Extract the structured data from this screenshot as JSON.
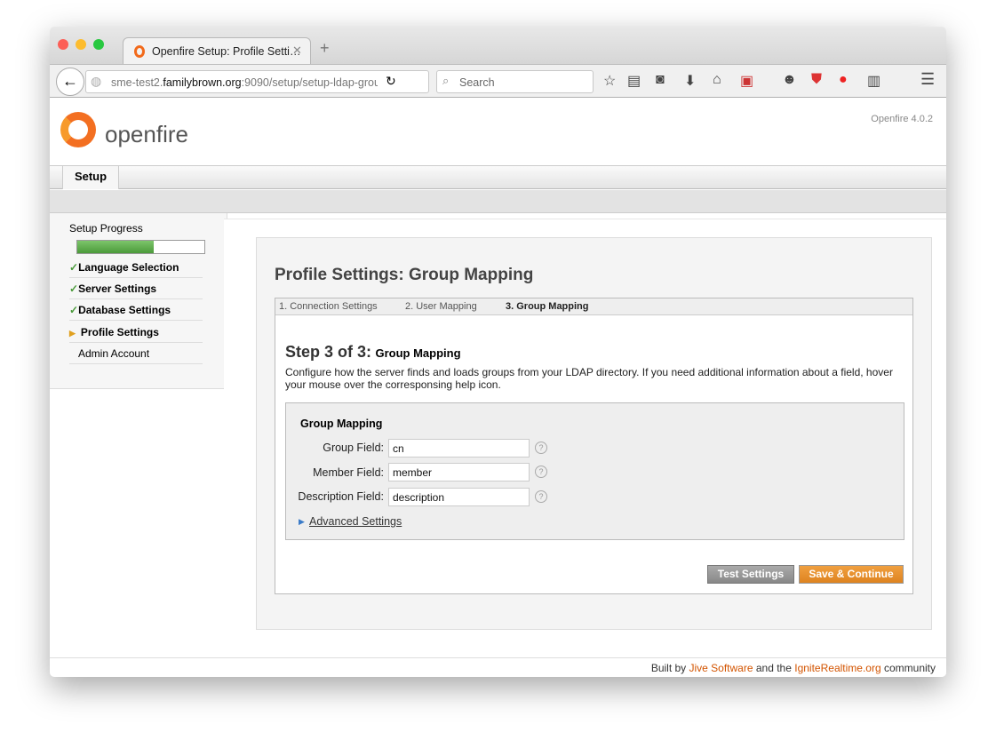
{
  "browser": {
    "tab_title": "Openfire Setup: Profile Setti…",
    "url_host_pre": "sme-test2.",
    "url_host": "familybrown.org",
    "url_rest": ":9090/setup/setup-ldap-grou",
    "search_placeholder": "Search"
  },
  "header": {
    "logo_text": "openfire",
    "version": "Openfire 4.0.2"
  },
  "nav": {
    "tab": "Setup"
  },
  "sidebar": {
    "title": "Setup Progress",
    "progress_percent": 60,
    "items": [
      {
        "label": "Language Selection",
        "state": "done"
      },
      {
        "label": "Server Settings",
        "state": "done"
      },
      {
        "label": "Database Settings",
        "state": "done"
      },
      {
        "label": "Profile Settings",
        "state": "current"
      },
      {
        "label": "Admin Account",
        "state": "pending"
      }
    ]
  },
  "main": {
    "title": "Profile Settings: Group Mapping",
    "steps": [
      "1. Connection Settings",
      "2. User Mapping",
      "3. Group Mapping"
    ],
    "step_heading": "Step 3 of 3:",
    "step_sub": "Group Mapping",
    "description": "Configure how the server finds and loads groups from your LDAP directory. If you need additional information about a field, hover your mouse over the corresponsing help icon.",
    "section_title": "Group Mapping",
    "fields": [
      {
        "label": "Group Field:",
        "value": "cn"
      },
      {
        "label": "Member Field:",
        "value": "member"
      },
      {
        "label": "Description Field:",
        "value": "description"
      }
    ],
    "advanced": "Advanced Settings",
    "test_button": "Test Settings",
    "save_button": "Save & Continue"
  },
  "footer": {
    "pre": "Built by ",
    "link1": "Jive Software",
    "mid": " and the ",
    "link2": "IgniteRealtime.org",
    "post": " community"
  },
  "colors": {
    "accent": "#e58a2b",
    "progress": "#5aab47",
    "link": "#d35400"
  }
}
